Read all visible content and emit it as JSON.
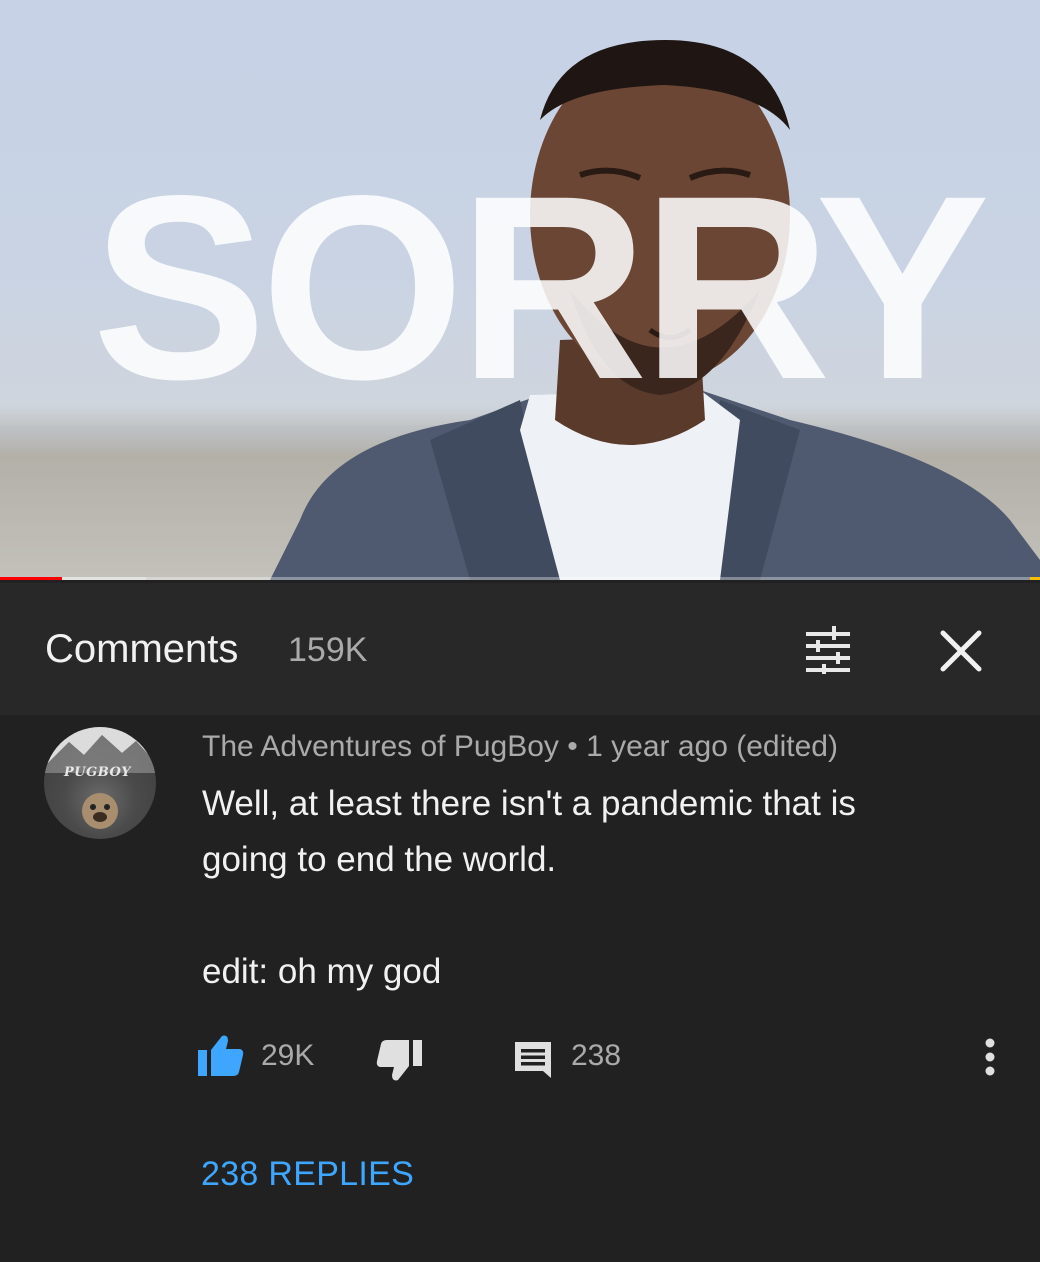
{
  "video": {
    "overlay_text": "SORRY",
    "progress_played": 0.06,
    "progress_buffered": 0.14
  },
  "comments_header": {
    "title": "Comments",
    "count": "159K",
    "sort_icon": "sort-filter-icon",
    "close_icon": "close-icon"
  },
  "comment": {
    "avatar_text": "PUGBOY",
    "author": "The Adventures of PugBoy",
    "separator": "•",
    "time": "1 year ago (edited)",
    "lines": [
      "Well, at least there isn't a pandemic that is",
      "going to end the world."
    ],
    "edit_line": "edit: oh my god",
    "likes": "29K",
    "replies_count": "238",
    "replies_link": "238 REPLIES"
  },
  "colors": {
    "background": "#212121",
    "header_bg": "#282828",
    "like_active": "#3ea6ff",
    "link": "#3ea6ff",
    "progress": "#ff0000"
  }
}
